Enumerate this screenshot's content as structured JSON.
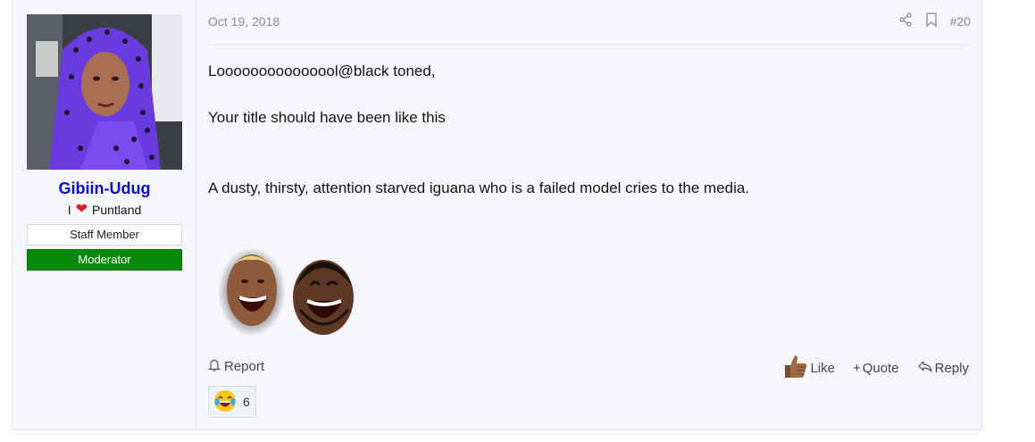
{
  "user": {
    "name": "Gibiin-Udug",
    "title_prefix": "I",
    "title_suffix": "Puntland",
    "banner_staff": "Staff Member",
    "banner_moderator": "Moderator"
  },
  "post": {
    "date": "Oct 19, 2018",
    "number": "#20",
    "lines": [
      "Looooooooooooool@black toned,",
      "Your title should have been like this",
      "A dusty, thirsty, attention starved iguana who is a failed model cries to the media."
    ]
  },
  "actions": {
    "report": "Report",
    "like": "Like",
    "quote": "Quote",
    "reply": "Reply"
  },
  "reactions": {
    "count": "6"
  },
  "colors": {
    "username": "#0b0bcf",
    "moderator_banner": "#0a8a0a",
    "post_bg": "#f5f7fb"
  },
  "icons": [
    "share-icon",
    "bookmark-icon",
    "bell-icon",
    "thumbs-up-icon",
    "plus-icon",
    "reply-icon",
    "laughing-emoji-icon",
    "heart-icon"
  ]
}
